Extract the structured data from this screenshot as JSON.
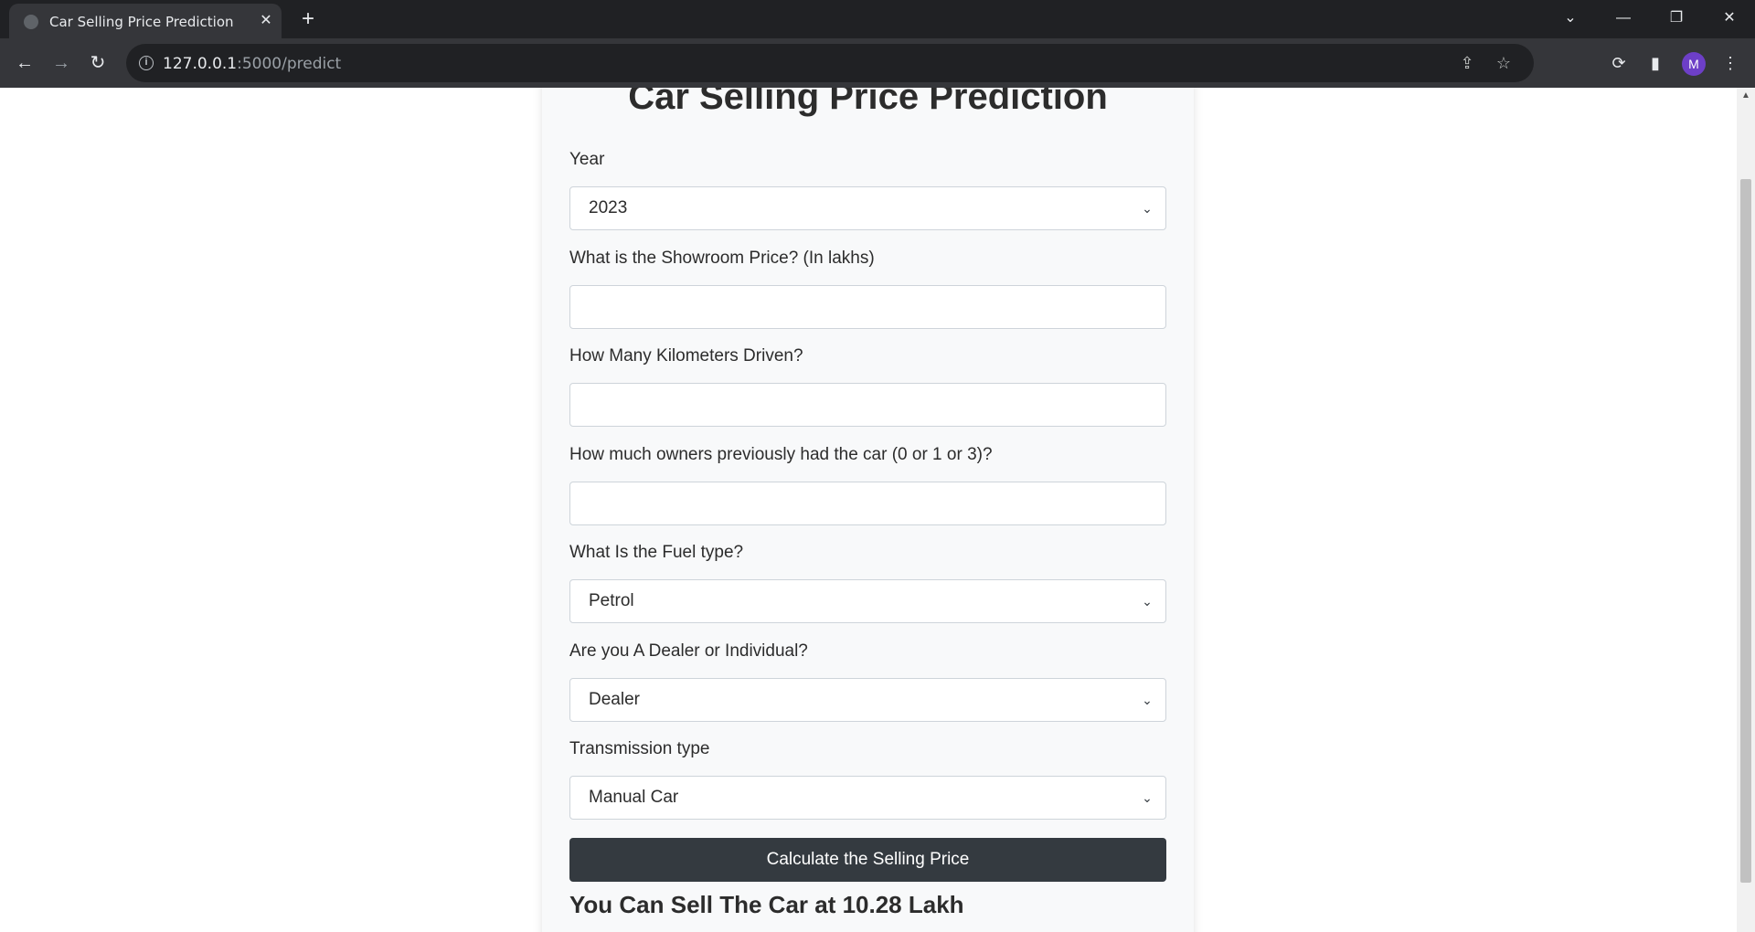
{
  "browser": {
    "tab_title": "Car Selling Price Prediction",
    "tab_close": "✕",
    "new_tab": "+",
    "url_host": "127.0.0.1",
    "url_path": ":5000/predict",
    "avatar_letter": "M"
  },
  "page": {
    "title": "Car Selling Price Prediction",
    "fields": [
      {
        "label": "Year",
        "type": "select",
        "value": "2023"
      },
      {
        "label": "What is the Showroom Price? (In lakhs)",
        "type": "input",
        "value": ""
      },
      {
        "label": "How Many Kilometers Driven?",
        "type": "input",
        "value": ""
      },
      {
        "label": "How much owners previously had the car (0 or 1 or 3)?",
        "type": "input",
        "value": ""
      },
      {
        "label": "What Is the Fuel type?",
        "type": "select",
        "value": "Petrol"
      },
      {
        "label": "Are you A Dealer or Individual?",
        "type": "select",
        "value": "Dealer"
      },
      {
        "label": "Transmission type",
        "type": "select",
        "value": "Manual Car"
      }
    ],
    "submit_label": "Calculate the Selling Price",
    "result_text": "You Can Sell The Car at 10.28 Lakh"
  },
  "icons": {
    "back": "back-arrow-icon",
    "forward": "forward-arrow-icon",
    "reload": "reload-icon",
    "info": "info-icon",
    "share": "share-icon",
    "bookmark": "star-icon",
    "extension": "extension-icon",
    "side_panel": "side-panel-icon",
    "menu": "kebab-menu-icon",
    "dropdown": "chevron-down-icon"
  },
  "colors": {
    "card_bg": "#f8f9fa",
    "button_bg": "#343a40",
    "browser_chrome": "#35363a",
    "avatar": "#6d3fc7"
  }
}
